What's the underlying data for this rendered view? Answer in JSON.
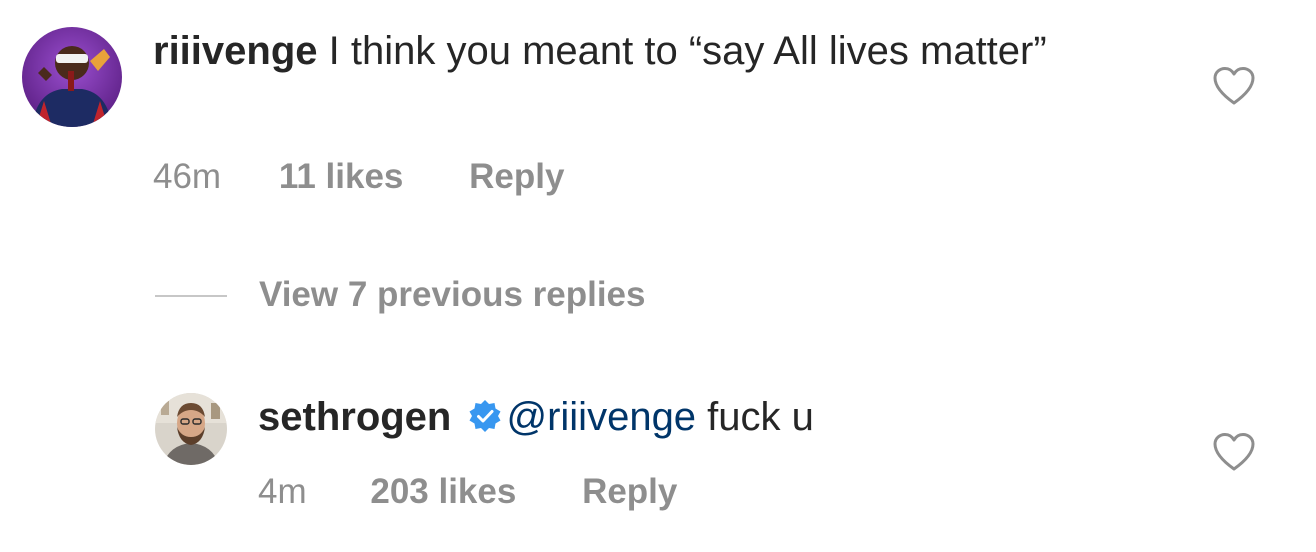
{
  "comments": [
    {
      "username": "riiivenge",
      "text": " I think you meant to “say All lives matter”",
      "time": "46m",
      "likes": "11 likes",
      "reply_label": "Reply",
      "avatar_icon": "performer-avatar"
    },
    {
      "username": "sethrogen",
      "verified": true,
      "mention": "@riiivenge",
      "text": " fuck u",
      "time": "4m",
      "likes": "203 likes",
      "reply_label": "Reply",
      "avatar_icon": "bearded-man-avatar"
    }
  ],
  "thread": {
    "view_replies_label": "View 7 previous replies"
  },
  "icons": {
    "like": "heart-outline-icon",
    "verified": "verified-badge-icon"
  },
  "colors": {
    "text": "#262626",
    "meta": "#8e8e8e",
    "mention": "#003569",
    "verified": "#3897f0",
    "avatar1_bg": "#7b2fa3"
  }
}
